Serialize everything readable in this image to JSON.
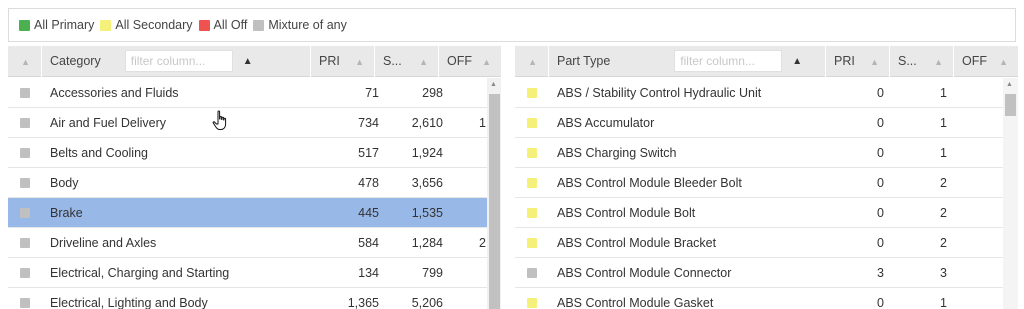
{
  "legend": [
    {
      "label": "All Primary",
      "color": "#4caf50"
    },
    {
      "label": "All Secondary",
      "color": "#f5f07a"
    },
    {
      "label": "All Off",
      "color": "#ef5350"
    },
    {
      "label": "Mixture of any",
      "color": "#c0c0c0"
    }
  ],
  "left_grid": {
    "columns": {
      "category": "Category",
      "pri": "PRI",
      "s": "S...",
      "off": "OFF"
    },
    "filter_placeholder": "filter column...",
    "rows": [
      {
        "label": "Accessories and Fluids",
        "pri": "71",
        "s": "298",
        "off": "",
        "status": "#c0c0c0",
        "selected": false
      },
      {
        "label": "Air and Fuel Delivery",
        "pri": "734",
        "s": "2,610",
        "off": "1",
        "status": "#c0c0c0",
        "selected": false
      },
      {
        "label": "Belts and Cooling",
        "pri": "517",
        "s": "1,924",
        "off": "",
        "status": "#c0c0c0",
        "selected": false
      },
      {
        "label": "Body",
        "pri": "478",
        "s": "3,656",
        "off": "",
        "status": "#c0c0c0",
        "selected": false
      },
      {
        "label": "Brake",
        "pri": "445",
        "s": "1,535",
        "off": "",
        "status": "#c0c0c0",
        "selected": true
      },
      {
        "label": "Driveline and Axles",
        "pri": "584",
        "s": "1,284",
        "off": "2",
        "status": "#c0c0c0",
        "selected": false
      },
      {
        "label": "Electrical, Charging and Starting",
        "pri": "134",
        "s": "799",
        "off": "",
        "status": "#c0c0c0",
        "selected": false
      },
      {
        "label": "Electrical, Lighting and Body",
        "pri": "1,365",
        "s": "5,206",
        "off": "",
        "status": "#c0c0c0",
        "selected": false
      }
    ]
  },
  "right_grid": {
    "columns": {
      "part_type": "Part Type",
      "pri": "PRI",
      "s": "S...",
      "off": "OFF"
    },
    "filter_placeholder": "filter column...",
    "rows": [
      {
        "label": "ABS / Stability Control Hydraulic Unit",
        "pri": "0",
        "s": "1",
        "status": "#f5f07a"
      },
      {
        "label": "ABS Accumulator",
        "pri": "0",
        "s": "1",
        "status": "#f5f07a"
      },
      {
        "label": "ABS Charging Switch",
        "pri": "0",
        "s": "1",
        "status": "#f5f07a"
      },
      {
        "label": "ABS Control Module Bleeder Bolt",
        "pri": "0",
        "s": "2",
        "status": "#f5f07a"
      },
      {
        "label": "ABS Control Module Bolt",
        "pri": "0",
        "s": "2",
        "status": "#f5f07a"
      },
      {
        "label": "ABS Control Module Bracket",
        "pri": "0",
        "s": "2",
        "status": "#f5f07a"
      },
      {
        "label": "ABS Control Module Connector",
        "pri": "3",
        "s": "3",
        "status": "#c0c0c0"
      },
      {
        "label": "ABS Control Module Gasket",
        "pri": "0",
        "s": "1",
        "status": "#f5f07a"
      }
    ]
  }
}
